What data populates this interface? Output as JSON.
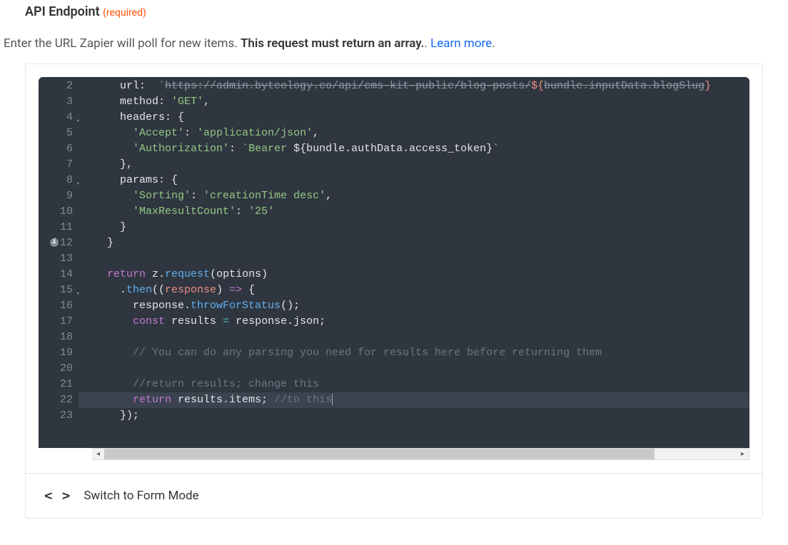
{
  "section_title": "API Endpoint",
  "required_label": "(required)",
  "description_pre": "Enter the URL Zapier will poll for new items. ",
  "description_bold": "This request must return an array.",
  "description_link": "Learn more",
  "switch_label": "Switch to Form Mode",
  "code_lines": [
    {
      "num": 2,
      "fold": false,
      "info": false,
      "segments": [
        {
          "t": "    url:  ",
          "cls": "c-white"
        },
        {
          "t": "`",
          "cls": "c-green"
        },
        {
          "t": "https://admin.byteology.co/api/cms-kit-public/blog-posts/",
          "cls": "c-gray",
          "strike": true
        },
        {
          "t": "${",
          "cls": "c-salmon"
        },
        {
          "t": "bundle.inputData.blogSlug",
          "cls": "c-gray",
          "strike": true
        },
        {
          "t": "}",
          "cls": "c-salmon"
        }
      ]
    },
    {
      "num": 3,
      "fold": false,
      "info": false,
      "segments": [
        {
          "t": "    method: ",
          "cls": "c-white"
        },
        {
          "t": "'GET'",
          "cls": "c-green"
        },
        {
          "t": ",",
          "cls": "c-white"
        }
      ]
    },
    {
      "num": 4,
      "fold": true,
      "info": false,
      "segments": [
        {
          "t": "    headers: {",
          "cls": "c-white"
        }
      ]
    },
    {
      "num": 5,
      "fold": false,
      "info": false,
      "segments": [
        {
          "t": "      ",
          "cls": ""
        },
        {
          "t": "'Accept'",
          "cls": "c-green"
        },
        {
          "t": ": ",
          "cls": "c-white"
        },
        {
          "t": "'application/json'",
          "cls": "c-green"
        },
        {
          "t": ",",
          "cls": "c-white"
        }
      ]
    },
    {
      "num": 6,
      "fold": false,
      "info": false,
      "segments": [
        {
          "t": "      ",
          "cls": ""
        },
        {
          "t": "'Authorization'",
          "cls": "c-green"
        },
        {
          "t": ": ",
          "cls": "c-white"
        },
        {
          "t": "`Bearer ",
          "cls": "c-green"
        },
        {
          "t": "${bundle.authData.access_token}",
          "cls": "c-white"
        },
        {
          "t": "`",
          "cls": "c-green"
        }
      ]
    },
    {
      "num": 7,
      "fold": false,
      "info": false,
      "segments": [
        {
          "t": "    },",
          "cls": "c-white"
        }
      ]
    },
    {
      "num": 8,
      "fold": true,
      "info": false,
      "segments": [
        {
          "t": "    params: {",
          "cls": "c-white"
        }
      ]
    },
    {
      "num": 9,
      "fold": false,
      "info": false,
      "segments": [
        {
          "t": "      ",
          "cls": ""
        },
        {
          "t": "'Sorting'",
          "cls": "c-green"
        },
        {
          "t": ": ",
          "cls": "c-white"
        },
        {
          "t": "'creationTime desc'",
          "cls": "c-green"
        },
        {
          "t": ",",
          "cls": "c-white"
        }
      ]
    },
    {
      "num": 10,
      "fold": false,
      "info": false,
      "segments": [
        {
          "t": "      ",
          "cls": ""
        },
        {
          "t": "'MaxResultCount'",
          "cls": "c-green"
        },
        {
          "t": ": ",
          "cls": "c-white"
        },
        {
          "t": "'25'",
          "cls": "c-green"
        }
      ]
    },
    {
      "num": 11,
      "fold": false,
      "info": false,
      "segments": [
        {
          "t": "    }",
          "cls": "c-white"
        }
      ]
    },
    {
      "num": 12,
      "fold": false,
      "info": true,
      "segments": [
        {
          "t": "  }",
          "cls": "c-white"
        }
      ]
    },
    {
      "num": 13,
      "fold": false,
      "info": false,
      "segments": []
    },
    {
      "num": 14,
      "fold": false,
      "info": false,
      "segments": [
        {
          "t": "  ",
          "cls": ""
        },
        {
          "t": "return",
          "cls": "c-purple"
        },
        {
          "t": " z.",
          "cls": "c-white"
        },
        {
          "t": "request",
          "cls": "c-blue"
        },
        {
          "t": "(options)",
          "cls": "c-white"
        }
      ]
    },
    {
      "num": 15,
      "fold": true,
      "info": false,
      "segments": [
        {
          "t": "    .",
          "cls": "c-white"
        },
        {
          "t": "then",
          "cls": "c-blue"
        },
        {
          "t": "((",
          "cls": "c-white"
        },
        {
          "t": "response",
          "cls": "c-salmon"
        },
        {
          "t": ") ",
          "cls": "c-white"
        },
        {
          "t": "=>",
          "cls": "c-purple"
        },
        {
          "t": " {",
          "cls": "c-white"
        }
      ]
    },
    {
      "num": 16,
      "fold": false,
      "info": false,
      "segments": [
        {
          "t": "      response.",
          "cls": "c-white"
        },
        {
          "t": "throwForStatus",
          "cls": "c-blue"
        },
        {
          "t": "();",
          "cls": "c-white"
        }
      ]
    },
    {
      "num": 17,
      "fold": false,
      "info": false,
      "segments": [
        {
          "t": "      ",
          "cls": ""
        },
        {
          "t": "const",
          "cls": "c-purple"
        },
        {
          "t": " results ",
          "cls": "c-white"
        },
        {
          "t": "=",
          "cls": "c-teal"
        },
        {
          "t": " response.json;",
          "cls": "c-white"
        }
      ]
    },
    {
      "num": 18,
      "fold": false,
      "info": false,
      "segments": []
    },
    {
      "num": 19,
      "fold": false,
      "info": false,
      "segments": [
        {
          "t": "      ",
          "cls": ""
        },
        {
          "t": "// You can do any parsing you need for results here before returning them",
          "cls": "c-comment"
        }
      ]
    },
    {
      "num": 20,
      "fold": false,
      "info": false,
      "segments": []
    },
    {
      "num": 21,
      "fold": false,
      "info": false,
      "segments": [
        {
          "t": "      ",
          "cls": ""
        },
        {
          "t": "//return results; change this",
          "cls": "c-comment"
        }
      ]
    },
    {
      "num": 22,
      "fold": false,
      "info": false,
      "hl": true,
      "segments": [
        {
          "t": "      ",
          "cls": ""
        },
        {
          "t": "return",
          "cls": "c-purple"
        },
        {
          "t": " results.items; ",
          "cls": "c-white"
        },
        {
          "t": "//to this",
          "cls": "c-comment"
        },
        {
          "t": "",
          "cls": "cursor"
        }
      ]
    },
    {
      "num": 23,
      "fold": false,
      "info": false,
      "segments": [
        {
          "t": "    });",
          "cls": "c-white"
        }
      ]
    }
  ]
}
